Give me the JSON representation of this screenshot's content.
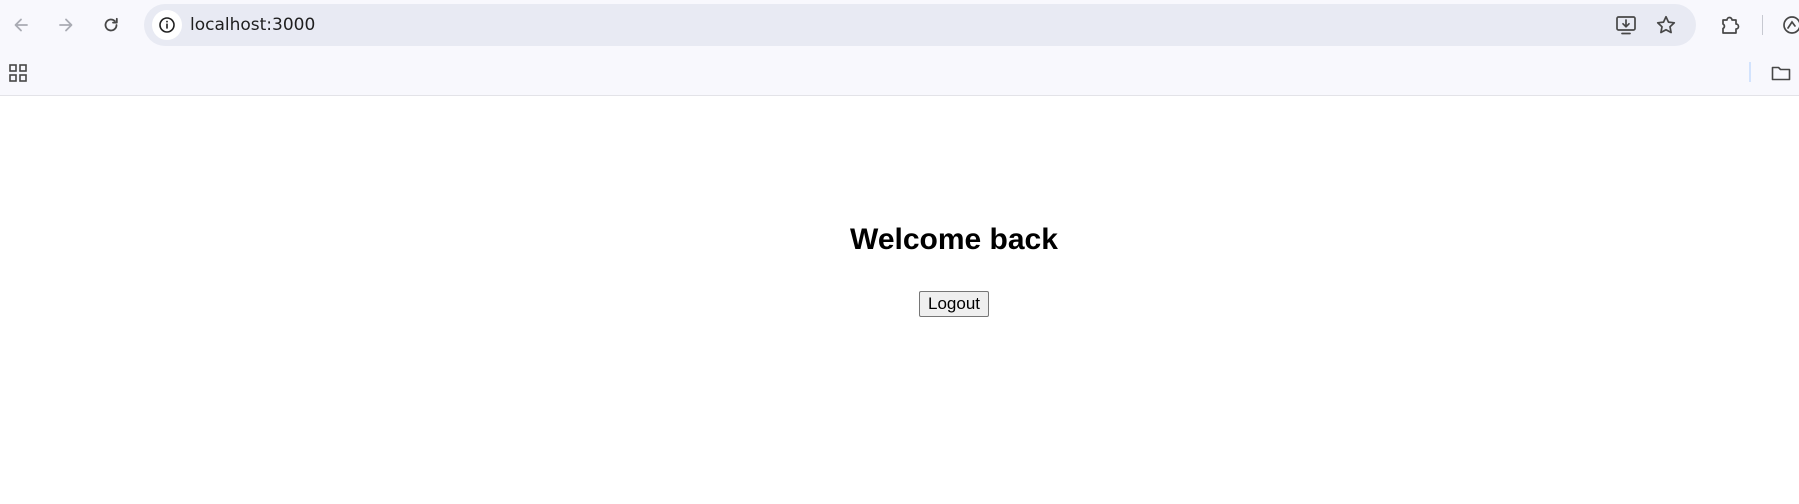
{
  "browser": {
    "url": "localhost:3000",
    "icons": {
      "back": "arrow-left-icon",
      "forward": "arrow-right-icon",
      "reload": "reload-icon",
      "site_info": "info-icon",
      "install": "install-app-icon",
      "bookmark": "star-icon",
      "extensions": "puzzle-icon",
      "apps": "apps-grid-icon",
      "folder": "folder-icon"
    }
  },
  "page": {
    "title": "Welcome back",
    "logout_label": "Logout"
  },
  "colors": {
    "chrome_bg": "#f8f8fd",
    "omnibox_bg": "#e8eaf3",
    "page_bg": "#ffffff"
  }
}
